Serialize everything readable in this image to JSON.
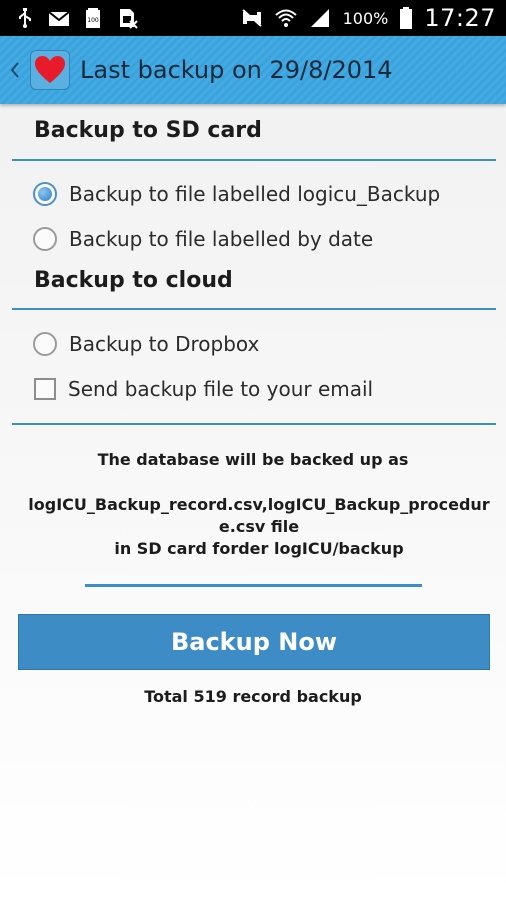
{
  "status_bar": {
    "battery_percent": "100%",
    "time": "17:27",
    "icons_left": [
      "usb-icon",
      "mail-icon",
      "battery-100-icon",
      "no-sim-icon"
    ],
    "icons_right": [
      "mute-icon",
      "wifi-icon",
      "signal-icon",
      "battery-icon"
    ]
  },
  "action_bar": {
    "title": "Last backup on 29/8/2014",
    "app_icon": "heart-icon"
  },
  "sd_section": {
    "title": "Backup to SD card",
    "options": [
      {
        "label": "Backup to file labelled logicu_Backup",
        "checked": true
      },
      {
        "label": "Backup to file labelled by date",
        "checked": false
      }
    ]
  },
  "cloud_section": {
    "title": "Backup to cloud",
    "dropbox_label": "Backup to Dropbox",
    "dropbox_checked": false,
    "email_label": "Send backup file to your email",
    "email_checked": false
  },
  "info": {
    "line1": "The database will be backed up as",
    "line2a": "logICU_Backup_record.csv,logICU_Backup_procedur",
    "line2b": "e.csv file",
    "line3": "in SD card forder logICU/backup"
  },
  "backup_button": {
    "label": "Backup Now"
  },
  "footer": {
    "total": "Total 519 record backup"
  },
  "colors": {
    "accent": "#3d8cc6",
    "action_bar": "#3aa2dc",
    "divider": "#3a8fc9"
  }
}
